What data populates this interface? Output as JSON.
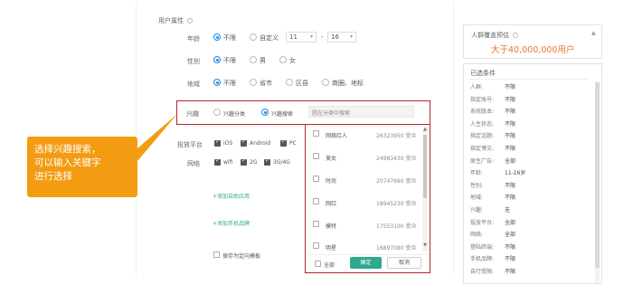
{
  "form": {
    "section_title": "用户属性",
    "age": {
      "label": "年龄",
      "options": [
        "不限",
        "自定义"
      ],
      "selected": 0,
      "min": "11",
      "sep": "-",
      "max": "16"
    },
    "gender": {
      "label": "性别",
      "options": [
        "不限",
        "男",
        "女"
      ],
      "selected": 0
    },
    "region": {
      "label": "地域",
      "options": [
        "不限",
        "省市",
        "区县",
        "商圈、地标"
      ],
      "selected": 0
    },
    "interest": {
      "label": "兴趣",
      "options": [
        "兴趣分类",
        "兴趣搜索"
      ],
      "selected": 1,
      "search_placeholder": "圆左分类中搜索"
    },
    "platform": {
      "label": "投放平台",
      "options": [
        "iOS",
        "Android",
        "PC"
      ]
    },
    "network": {
      "label": "网络",
      "options": [
        "wifi",
        "2G",
        "3G/4G"
      ]
    },
    "add_app_link": "+添加自助应用",
    "add_phone_link": "+添加手机品牌",
    "save_template_label": "保存为定向模板"
  },
  "dropdown": {
    "items": [
      {
        "name": "网络红人",
        "count": "26323950 受众"
      },
      {
        "name": "美女",
        "count": "24983430 受众"
      },
      {
        "name": "时尚",
        "count": "20747690 受众"
      },
      {
        "name": "网红",
        "count": "18945230 受众"
      },
      {
        "name": "模特",
        "count": "17553100 受众"
      },
      {
        "name": "明星",
        "count": "16897080 受众"
      }
    ],
    "select_all": "全部",
    "confirm": "确定",
    "cancel": "取消"
  },
  "estimate": {
    "title": "人群覆盖预估",
    "value": "大于40,000,000用户"
  },
  "conditions": {
    "title": "已选条件",
    "rows": [
      {
        "k": "人群:",
        "v": "不限"
      },
      {
        "k": "指定账号:",
        "v": "不限"
      },
      {
        "k": "系统版本:",
        "v": "不限"
      },
      {
        "k": "人生状态:",
        "v": "不限"
      },
      {
        "k": "指定话题:",
        "v": "不限"
      },
      {
        "k": "指定博文:",
        "v": "不限"
      },
      {
        "k": "原生广告:",
        "v": "全部"
      },
      {
        "k": "年龄:",
        "v": "11-16岁"
      },
      {
        "k": "性别:",
        "v": "不限"
      },
      {
        "k": "地域:",
        "v": "不限"
      },
      {
        "k": "兴趣:",
        "v": "无"
      },
      {
        "k": "投放平台:",
        "v": "全部"
      },
      {
        "k": "网络:",
        "v": "全部"
      },
      {
        "k": "登陆终端:",
        "v": "不限"
      },
      {
        "k": "手机品牌:",
        "v": "不限"
      },
      {
        "k": "自行受限:",
        "v": "不限"
      }
    ]
  },
  "callout": {
    "line1": "选择兴趣搜索，",
    "line2": "可以输入关键字",
    "line3": "进行选择"
  },
  "colors": {
    "highlight_border": "#b2262d",
    "callout_bg": "#f39c12",
    "confirm_bg": "#2eaa8e",
    "estimate_value": "#e8772e",
    "radio_active": "#1e88e5"
  }
}
